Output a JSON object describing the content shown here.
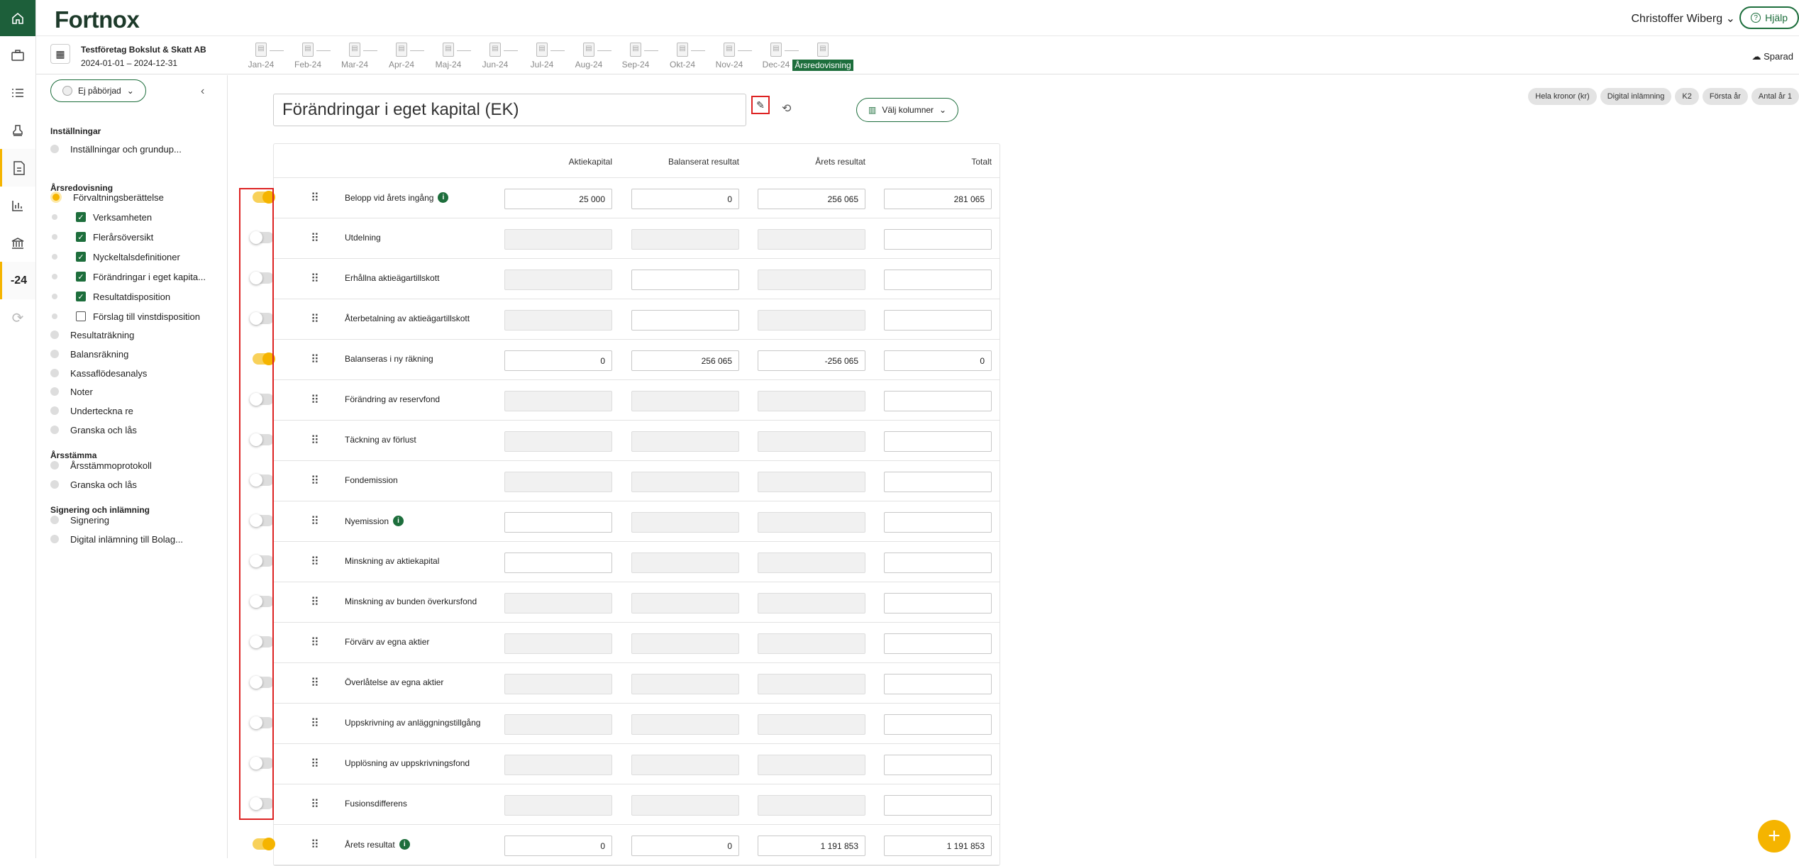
{
  "app": {
    "logo": "Fortnox",
    "user": "Christoffer Wiberg",
    "help": "Hjälp",
    "saved": "Sparad"
  },
  "rail": {
    "year": "-24"
  },
  "company": {
    "name": "Testföretag Bokslut & Skatt AB",
    "period": "2024-01-01 – 2024-12-31"
  },
  "timeline": [
    "Jan-24",
    "Feb-24",
    "Mar-24",
    "Apr-24",
    "Maj-24",
    "Jun-24",
    "Jul-24",
    "Aug-24",
    "Sep-24",
    "Okt-24",
    "Nov-24",
    "Dec-24",
    "Årsredovisning"
  ],
  "sidebar": {
    "status": "Ej påbörjad",
    "sections": [
      {
        "title": "Inställningar",
        "items": [
          {
            "label": "Inställningar och grundup...",
            "state": "none"
          }
        ]
      },
      {
        "title": "Årsredovisning",
        "items": [
          {
            "label": "Förvaltningsberättelse",
            "state": "active"
          },
          {
            "label": "Verksamheten",
            "state": "checked",
            "child": true
          },
          {
            "label": "Flerårsöversikt",
            "state": "checked",
            "child": true
          },
          {
            "label": "Nyckeltalsdefinitioner",
            "state": "checked",
            "child": true
          },
          {
            "label": "Förändringar i eget kapita...",
            "state": "checked",
            "child": true
          },
          {
            "label": "Resultatdisposition",
            "state": "checked",
            "child": true
          },
          {
            "label": "Förslag till vinstdisposition",
            "state": "unchecked",
            "child": true
          },
          {
            "label": "Resultaträkning",
            "state": "none"
          },
          {
            "label": "Balansräkning",
            "state": "none"
          },
          {
            "label": "Kassaflödesanalys",
            "state": "none"
          },
          {
            "label": "Noter",
            "state": "none"
          },
          {
            "label": "Underteckna re",
            "state": "none"
          },
          {
            "label": "Granska och lås",
            "state": "none"
          }
        ]
      },
      {
        "title": "Årsstämma",
        "items": [
          {
            "label": "Årsstämmoprotokoll",
            "state": "none"
          },
          {
            "label": "Granska och lås",
            "state": "none"
          }
        ]
      },
      {
        "title": "Signering och inlämning",
        "items": [
          {
            "label": "Signering",
            "state": "none"
          },
          {
            "label": "Digital inlämning till Bolag...",
            "state": "none"
          }
        ]
      }
    ]
  },
  "main": {
    "title": "Förändringar i eget kapital (EK)",
    "columns_button": "Välj kolumner",
    "chips": [
      "Hela kronor (kr)",
      "Digital inlämning",
      "K2",
      "Första år",
      "Antal år 1"
    ],
    "headers": [
      "Aktiekapital",
      "Balanserat resultat",
      "Årets resultat",
      "Totalt"
    ],
    "rows": [
      {
        "label": "Belopp vid årets ingång",
        "info": true,
        "on": true,
        "values": [
          "25 000",
          "0",
          "256 065",
          "281 065"
        ],
        "disabled": [
          false,
          false,
          false,
          false
        ]
      },
      {
        "label": "Utdelning",
        "info": false,
        "on": false,
        "values": [
          "",
          "",
          "",
          ""
        ],
        "disabled": [
          true,
          true,
          true,
          false
        ]
      },
      {
        "label": "Erhållna aktieägartillskott",
        "info": false,
        "on": false,
        "values": [
          "",
          "",
          "",
          ""
        ],
        "disabled": [
          true,
          false,
          true,
          false
        ]
      },
      {
        "label": "Återbetalning av aktieägartillskott",
        "info": false,
        "on": false,
        "values": [
          "",
          "",
          "",
          ""
        ],
        "disabled": [
          true,
          false,
          true,
          false
        ]
      },
      {
        "label": "Balanseras i ny räkning",
        "info": false,
        "on": true,
        "values": [
          "0",
          "256 065",
          "-256 065",
          "0"
        ],
        "disabled": [
          false,
          false,
          false,
          false
        ]
      },
      {
        "label": "Förändring av reservfond",
        "info": false,
        "on": false,
        "values": [
          "",
          "",
          "",
          ""
        ],
        "disabled": [
          true,
          true,
          true,
          false
        ]
      },
      {
        "label": "Täckning av förlust",
        "info": false,
        "on": false,
        "values": [
          "",
          "",
          "",
          ""
        ],
        "disabled": [
          true,
          true,
          true,
          false
        ]
      },
      {
        "label": "Fondemission",
        "info": false,
        "on": false,
        "values": [
          "",
          "",
          "",
          ""
        ],
        "disabled": [
          true,
          true,
          true,
          false
        ]
      },
      {
        "label": "Nyemission",
        "info": true,
        "on": false,
        "values": [
          "",
          "",
          "",
          ""
        ],
        "disabled": [
          false,
          true,
          true,
          false
        ]
      },
      {
        "label": "Minskning av aktiekapital",
        "info": false,
        "on": false,
        "values": [
          "",
          "",
          "",
          ""
        ],
        "disabled": [
          false,
          true,
          true,
          false
        ]
      },
      {
        "label": "Minskning av bunden överkursfond",
        "info": false,
        "on": false,
        "values": [
          "",
          "",
          "",
          ""
        ],
        "disabled": [
          true,
          true,
          true,
          false
        ]
      },
      {
        "label": "Förvärv av egna aktier",
        "info": false,
        "on": false,
        "values": [
          "",
          "",
          "",
          ""
        ],
        "disabled": [
          true,
          true,
          true,
          false
        ]
      },
      {
        "label": "Överlåtelse av egna aktier",
        "info": false,
        "on": false,
        "values": [
          "",
          "",
          "",
          ""
        ],
        "disabled": [
          true,
          true,
          true,
          false
        ]
      },
      {
        "label": "Uppskrivning av anläggningstillgång",
        "info": false,
        "on": false,
        "values": [
          "",
          "",
          "",
          ""
        ],
        "disabled": [
          true,
          true,
          true,
          false
        ]
      },
      {
        "label": "Upplösning av uppskrivningsfond",
        "info": false,
        "on": false,
        "values": [
          "",
          "",
          "",
          ""
        ],
        "disabled": [
          true,
          true,
          true,
          false
        ]
      },
      {
        "label": "Fusionsdifferens",
        "info": false,
        "on": false,
        "values": [
          "",
          "",
          "",
          ""
        ],
        "disabled": [
          true,
          true,
          true,
          false
        ]
      },
      {
        "label": "Årets resultat",
        "info": true,
        "on": true,
        "values": [
          "0",
          "0",
          "1 191 853",
          "1 191 853"
        ],
        "disabled": [
          false,
          false,
          false,
          false
        ]
      }
    ]
  }
}
